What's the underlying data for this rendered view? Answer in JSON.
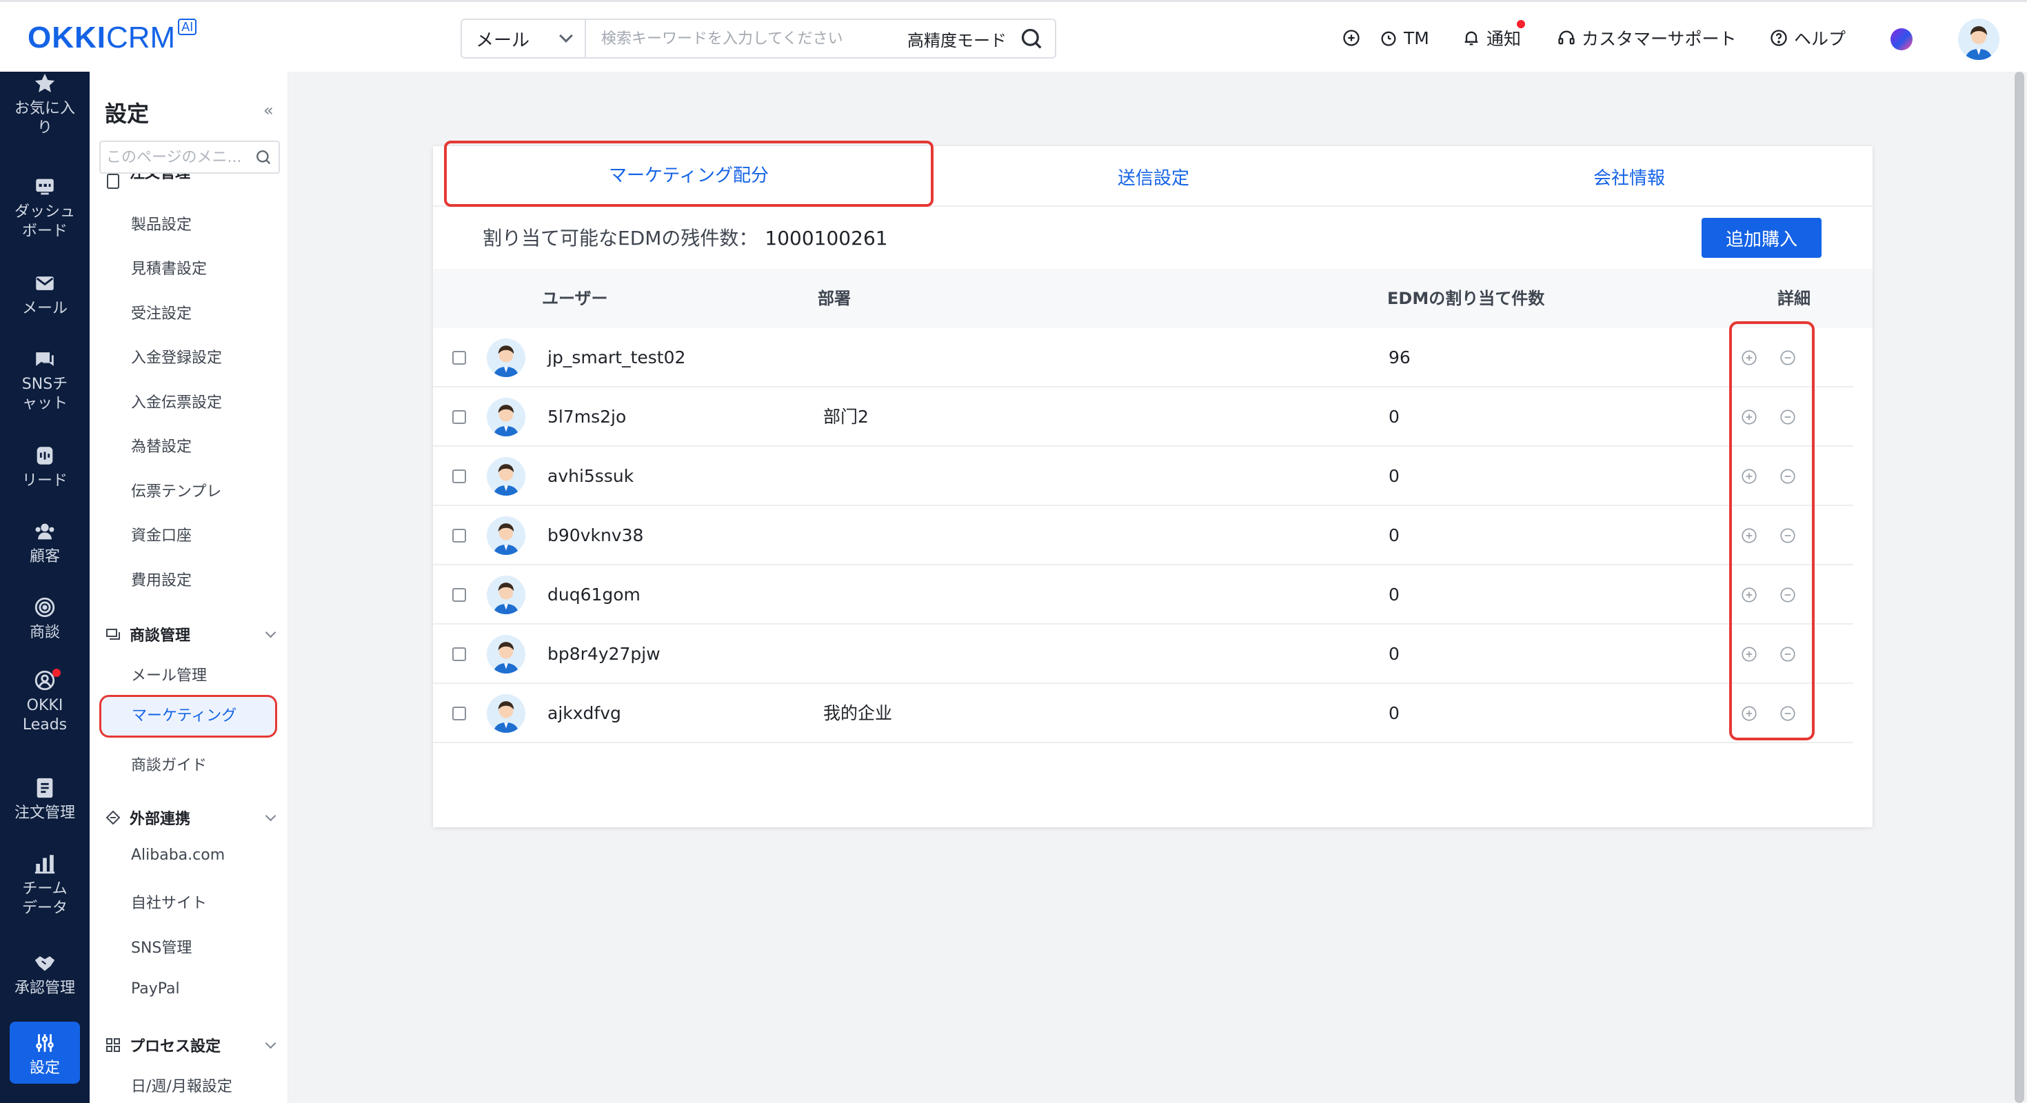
{
  "brand": {
    "logo_main": "OKKI",
    "logo_sub": "CRM",
    "logo_badge": "AI",
    "color": "#1463e6"
  },
  "search": {
    "type_label": "メール",
    "placeholder": "検索キーワードを入力してください",
    "mode_label": "高精度モード"
  },
  "topnav": {
    "tm_label": "TM",
    "notify_label": "通知",
    "support_label": "カスタマーサポート",
    "help_label": "ヘルプ"
  },
  "rail": {
    "items": [
      {
        "label": "お気に入り",
        "icon": "star-icon"
      },
      {
        "label": "ダッシュボード",
        "icon": "dashboard-icon"
      },
      {
        "label": "メール",
        "icon": "mail-icon"
      },
      {
        "label": "SNSチャット",
        "icon": "chat-icon"
      },
      {
        "label": "リード",
        "icon": "lead-icon"
      },
      {
        "label": "顧客",
        "icon": "customers-icon"
      },
      {
        "label": "商談",
        "icon": "target-icon"
      },
      {
        "label": "OKKI Leads",
        "icon": "okki-leads-icon"
      },
      {
        "label": "注文管理",
        "icon": "order-icon"
      },
      {
        "label": "チームデータ",
        "icon": "bar-chart-icon"
      },
      {
        "label": "承認管理",
        "icon": "handshake-icon"
      },
      {
        "label": "設定",
        "icon": "settings-icon"
      }
    ]
  },
  "submenu": {
    "title": "設定",
    "collapse": "«",
    "search_placeholder": "このページのメニ...",
    "group_order": "注文管理",
    "order_items": [
      "製品設定",
      "見積書設定",
      "受注設定",
      "入金登録設定",
      "入金伝票設定",
      "為替設定",
      "伝票テンプレ",
      "資金口座",
      "費用設定"
    ],
    "group_deal": "商談管理",
    "deal_items": [
      "メール管理",
      "マーケティング",
      "商談ガイド"
    ],
    "group_external": "外部連携",
    "external_items": [
      "Alibaba.com",
      "自社サイト",
      "SNS管理",
      "PayPal"
    ],
    "group_process": "プロセス設定",
    "process_items": [
      "日/週/月報設定"
    ]
  },
  "tabs": [
    "マーケティング配分",
    "送信設定",
    "会社情報"
  ],
  "summary": {
    "label": "割り当て可能なEDMの残件数：",
    "value": "1000100261"
  },
  "buy_button": "追加購入",
  "table": {
    "columns": [
      "ユーザー",
      "部署",
      "EDMの割り当て件数",
      "詳細"
    ],
    "rows": [
      {
        "user": "jp_smart_test02",
        "dept": "",
        "edm": "96"
      },
      {
        "user": "5l7ms2jo",
        "dept": "部门2",
        "edm": "0"
      },
      {
        "user": "avhi5ssuk",
        "dept": "",
        "edm": "0"
      },
      {
        "user": "b90vknv38",
        "dept": "",
        "edm": "0"
      },
      {
        "user": "duq61gom",
        "dept": "",
        "edm": "0"
      },
      {
        "user": "bp8r4y27pjw",
        "dept": "",
        "edm": "0"
      },
      {
        "user": "ajkxdfvg",
        "dept": "我的企业",
        "edm": "0"
      }
    ]
  },
  "colors": {
    "primary": "#1463e6",
    "rail_bg": "#0c1d3d",
    "highlight": "#e53935",
    "notify": "#f5222d"
  }
}
